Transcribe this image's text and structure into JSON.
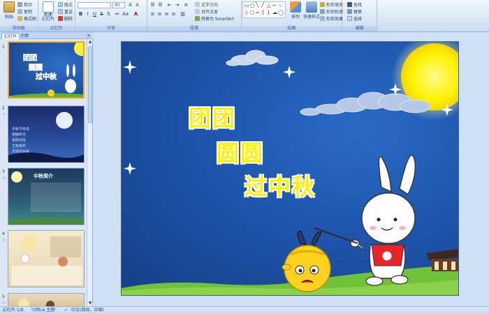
{
  "ribbon": {
    "clipboard": {
      "paste": "粘贴",
      "cut": "剪切",
      "copy": "复制",
      "format_painter": "格式刷",
      "label": "剪贴板"
    },
    "slides": {
      "new_slide": "新建\n幻灯片",
      "layout": "版式",
      "reset": "重设",
      "delete": "删除",
      "label": "幻灯片"
    },
    "font": {
      "font_size": "40",
      "label": "字体"
    },
    "paragraph": {
      "text_direction": "文字方向",
      "align_text": "对齐文本",
      "smartart": "转换为 SmartArt",
      "label": "段落"
    },
    "drawing": {
      "arrange": "排列",
      "quick_styles": "快速样式",
      "shape_fill": "形状填充",
      "shape_outline": "形状轮廓",
      "shape_effects": "形状效果",
      "label": "绘图"
    },
    "editing": {
      "find": "查找",
      "replace": "替换",
      "select": "选择",
      "label": "编辑"
    }
  },
  "pane": {
    "tab_slides": "幻灯片",
    "tab_outline": "大纲",
    "close": "×",
    "thumbs": [
      {
        "num": "1",
        "title_lines": [
          "团团",
          "圆圆",
          "过中秋"
        ]
      },
      {
        "num": "2",
        "text_lines": [
          "中秋节传说",
          "嫦娥奔月",
          "吴刚伐桂",
          "玉兔捣药",
          "月饼的由来"
        ]
      },
      {
        "num": "3",
        "title": "中秋简介"
      },
      {
        "num": "4"
      },
      {
        "num": "5"
      }
    ]
  },
  "slide": {
    "title_lines": [
      "团团",
      "圆圆",
      "过中秋"
    ]
  },
  "status": {
    "slide_info": "幻灯片 1/9",
    "theme": "\"Office 主题\"",
    "language": "中文(简体，中国)"
  },
  "colors": {
    "accent": "#fff200",
    "sky": "#1e55ac",
    "ribbon": "#dce9f8"
  }
}
